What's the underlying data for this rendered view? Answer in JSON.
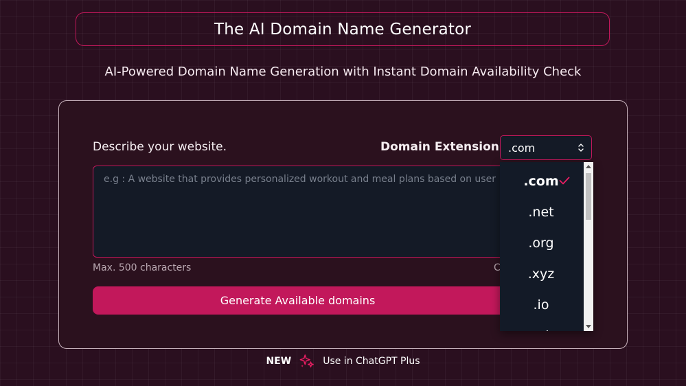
{
  "header": {
    "title": "The AI Domain Name Generator",
    "subtitle": "AI-Powered Domain Name Generation with Instant Domain Availability Check"
  },
  "form": {
    "describe_label": "Describe your website.",
    "textarea_placeholder": "e.g : A website that provides personalized workout and meal plans based on user",
    "max_chars_note": "Max. 500 characters",
    "char_count_partial": "C",
    "extension_label": "Domain Extension",
    "extension_selected": ".com",
    "generate_button": "Generate Available domains"
  },
  "dropdown": {
    "options": [
      ".com",
      ".net",
      ".org",
      ".xyz",
      ".io",
      ".ai"
    ],
    "selected_index": 0
  },
  "footer": {
    "badge": "NEW",
    "link_text": "Use in ChatGPT Plus"
  },
  "colors": {
    "accent": "#c2185b",
    "background": "#2a0f1f",
    "input_bg": "#141a26"
  }
}
